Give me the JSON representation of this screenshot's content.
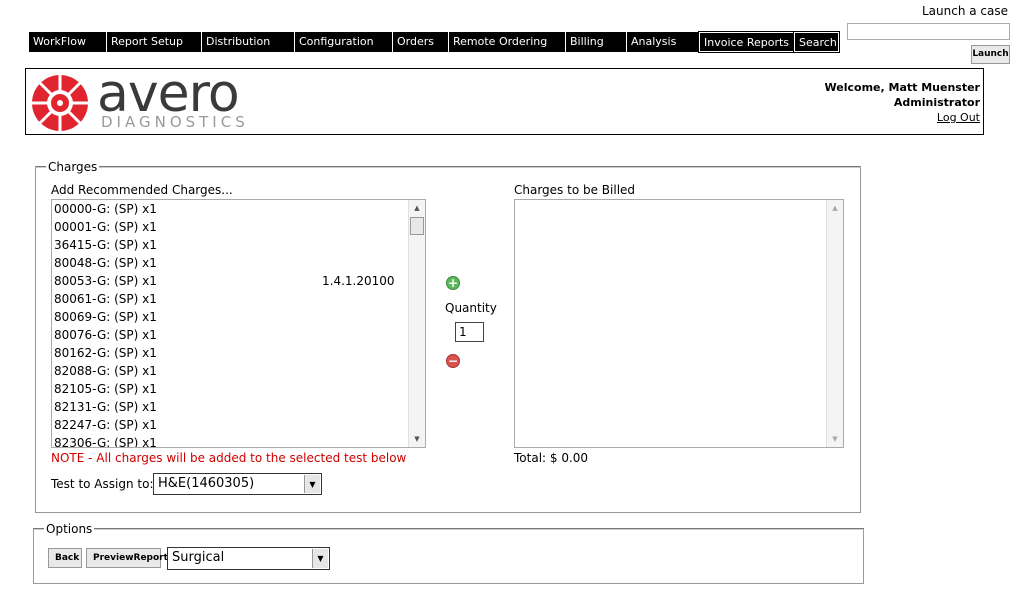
{
  "nav": {
    "items": [
      "WorkFlow",
      "Report Setup",
      "Distribution",
      "Configuration",
      "Orders",
      "Remote Ordering",
      "Billing",
      "Analysis",
      "Invoice Reports",
      "Search"
    ]
  },
  "launch": {
    "label": "Launch a case",
    "input_value": "",
    "button_label": "Launch"
  },
  "header": {
    "logo_word": "avero",
    "logo_sub": "DIAGNOSTICS",
    "welcome": "Welcome, Matt Muenster",
    "role": "Administrator",
    "logout": "Log Out"
  },
  "charges": {
    "legend": "Charges",
    "recommended_label": "Add Recommended Charges...",
    "recommended_items": [
      "00000-G: (SP) x1",
      "00001-G: (SP) x1",
      "36415-G: (SP) x1",
      "80048-G: (SP) x1",
      "80053-G: (SP) x1",
      "80061-G: (SP) x1",
      "80069-G: (SP) x1",
      "80076-G: (SP) x1",
      "80162-G: (SP) x1",
      "82088-G: (SP) x1",
      "82105-G: (SP) x1",
      "82131-G: (SP) x1",
      "82247-G: (SP) x1",
      "82306-G: (SP) x1"
    ],
    "version": "1.4.1.20100",
    "quantity_label": "Quantity",
    "quantity_value": "1",
    "billed_label": "Charges to be Billed",
    "note": "NOTE - All charges will be added to the selected test below",
    "total": "Total: $ 0.00",
    "assign_label": "Test to Assign to:",
    "assign_value": "H&E(1460305)"
  },
  "options": {
    "legend": "Options",
    "back_label": "Back",
    "preview_label": "PreviewReport",
    "report_type": "Surgical"
  },
  "colors": {
    "note": "#d00000",
    "brand_red": "#e0252f",
    "add_green": "#5cb85c",
    "remove_red": "#d9534f"
  }
}
